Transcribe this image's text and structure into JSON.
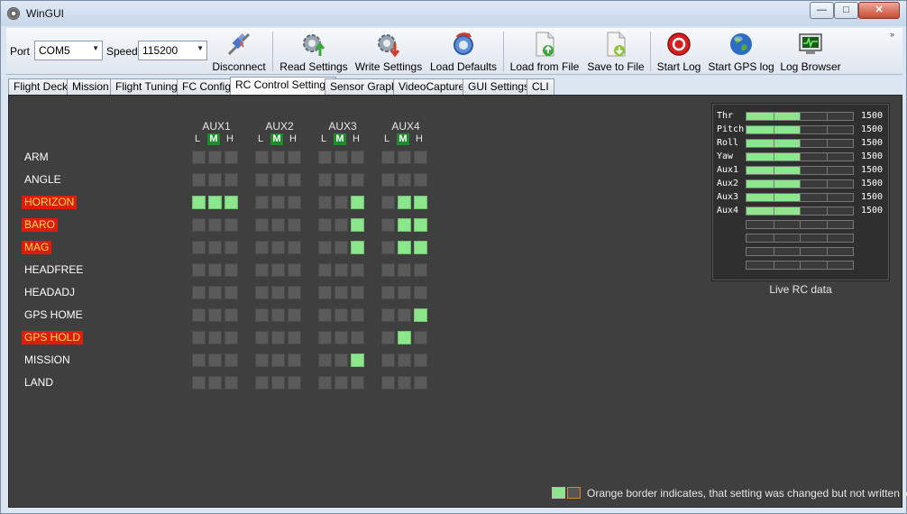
{
  "window": {
    "title": "WinGUI",
    "minimize": "—",
    "maximize": "□",
    "close": "✕"
  },
  "toolbar": {
    "port_label": "Port",
    "port_value": "COM5",
    "speed_label": "Speed",
    "speed_value": "115200",
    "buttons": [
      {
        "label": "Disconnect",
        "icon": "disconnect-icon"
      },
      {
        "label": "Read Settings",
        "icon": "read-settings-icon"
      },
      {
        "label": "Write Settings",
        "icon": "write-settings-icon"
      },
      {
        "label": "Load Defaults",
        "icon": "load-defaults-icon"
      },
      {
        "label": "Load from File",
        "icon": "load-file-icon"
      },
      {
        "label": "Save to File",
        "icon": "save-file-icon"
      },
      {
        "label": "Start Log",
        "icon": "record-icon"
      },
      {
        "label": "Start GPS log",
        "icon": "globe-icon"
      },
      {
        "label": "Log Browser",
        "icon": "log-browser-icon"
      }
    ],
    "overflow": "»"
  },
  "tabs": [
    {
      "label": "Flight Deck"
    },
    {
      "label": "Mission"
    },
    {
      "label": "Flight Tuning"
    },
    {
      "label": "FC Config"
    },
    {
      "label": "RC Control Settings",
      "active": true
    },
    {
      "label": "Sensor Graph"
    },
    {
      "label": "VideoCapture"
    },
    {
      "label": "GUI Settings"
    },
    {
      "label": "CLI"
    }
  ],
  "aux": {
    "channels": [
      "AUX1",
      "AUX2",
      "AUX3",
      "AUX4"
    ],
    "positions": [
      "L",
      "M",
      "H"
    ]
  },
  "modes": [
    {
      "name": "ARM",
      "changed": false,
      "states": [
        [
          0,
          0,
          0
        ],
        [
          0,
          0,
          0
        ],
        [
          0,
          0,
          0
        ],
        [
          0,
          0,
          0
        ]
      ]
    },
    {
      "name": "ANGLE",
      "changed": false,
      "states": [
        [
          0,
          0,
          0
        ],
        [
          0,
          0,
          0
        ],
        [
          0,
          0,
          0
        ],
        [
          0,
          0,
          0
        ]
      ]
    },
    {
      "name": "HORIZON",
      "changed": true,
      "states": [
        [
          1,
          1,
          1
        ],
        [
          0,
          0,
          0
        ],
        [
          0,
          0,
          1
        ],
        [
          0,
          1,
          1
        ]
      ]
    },
    {
      "name": "BARO",
      "changed": true,
      "states": [
        [
          0,
          0,
          0
        ],
        [
          0,
          0,
          0
        ],
        [
          0,
          0,
          1
        ],
        [
          0,
          1,
          1
        ]
      ]
    },
    {
      "name": "MAG",
      "changed": true,
      "states": [
        [
          0,
          0,
          0
        ],
        [
          0,
          0,
          0
        ],
        [
          0,
          0,
          1
        ],
        [
          0,
          1,
          1
        ]
      ]
    },
    {
      "name": "HEADFREE",
      "changed": false,
      "states": [
        [
          0,
          0,
          0
        ],
        [
          0,
          0,
          0
        ],
        [
          0,
          0,
          0
        ],
        [
          0,
          0,
          0
        ]
      ]
    },
    {
      "name": "HEADADJ",
      "changed": false,
      "states": [
        [
          0,
          0,
          0
        ],
        [
          0,
          0,
          0
        ],
        [
          0,
          0,
          0
        ],
        [
          0,
          0,
          0
        ]
      ]
    },
    {
      "name": "GPS HOME",
      "changed": false,
      "states": [
        [
          0,
          0,
          0
        ],
        [
          0,
          0,
          0
        ],
        [
          0,
          0,
          0
        ],
        [
          0,
          0,
          1
        ]
      ]
    },
    {
      "name": "GPS HOLD",
      "changed": true,
      "states": [
        [
          0,
          0,
          0
        ],
        [
          0,
          0,
          0
        ],
        [
          0,
          0,
          0
        ],
        [
          0,
          1,
          0
        ]
      ]
    },
    {
      "name": "MISSION",
      "changed": false,
      "states": [
        [
          0,
          0,
          0
        ],
        [
          0,
          0,
          0
        ],
        [
          0,
          0,
          1
        ],
        [
          0,
          0,
          0
        ]
      ]
    },
    {
      "name": "LAND",
      "changed": false,
      "states": [
        [
          0,
          0,
          0
        ],
        [
          0,
          0,
          0
        ],
        [
          0,
          0,
          0
        ],
        [
          0,
          0,
          0
        ]
      ]
    }
  ],
  "live_rc": {
    "caption": "Live RC data",
    "channels": [
      {
        "name": "Thr",
        "value": "1500",
        "level": 0.5
      },
      {
        "name": "Pitch",
        "value": "1500",
        "level": 0.5
      },
      {
        "name": "Roll",
        "value": "1500",
        "level": 0.5
      },
      {
        "name": "Yaw",
        "value": "1500",
        "level": 0.5
      },
      {
        "name": "Aux1",
        "value": "1500",
        "level": 0.5
      },
      {
        "name": "Aux2",
        "value": "1500",
        "level": 0.5
      },
      {
        "name": "Aux3",
        "value": "1500",
        "level": 0.5
      },
      {
        "name": "Aux4",
        "value": "1500",
        "level": 0.5
      },
      {
        "name": "",
        "value": "",
        "level": 0
      },
      {
        "name": "",
        "value": "",
        "level": 0
      },
      {
        "name": "",
        "value": "",
        "level": 0
      },
      {
        "name": "",
        "value": "",
        "level": 0
      }
    ]
  },
  "legend": {
    "text": "Orange border indicates, that setting was changed but not written to FC"
  },
  "colors": {
    "active_cell": "#8ce68c",
    "changed_label_bg": "#e11a0e",
    "changed_label_text": "#ffe04a",
    "panel_bg": "#3f3f3f"
  }
}
